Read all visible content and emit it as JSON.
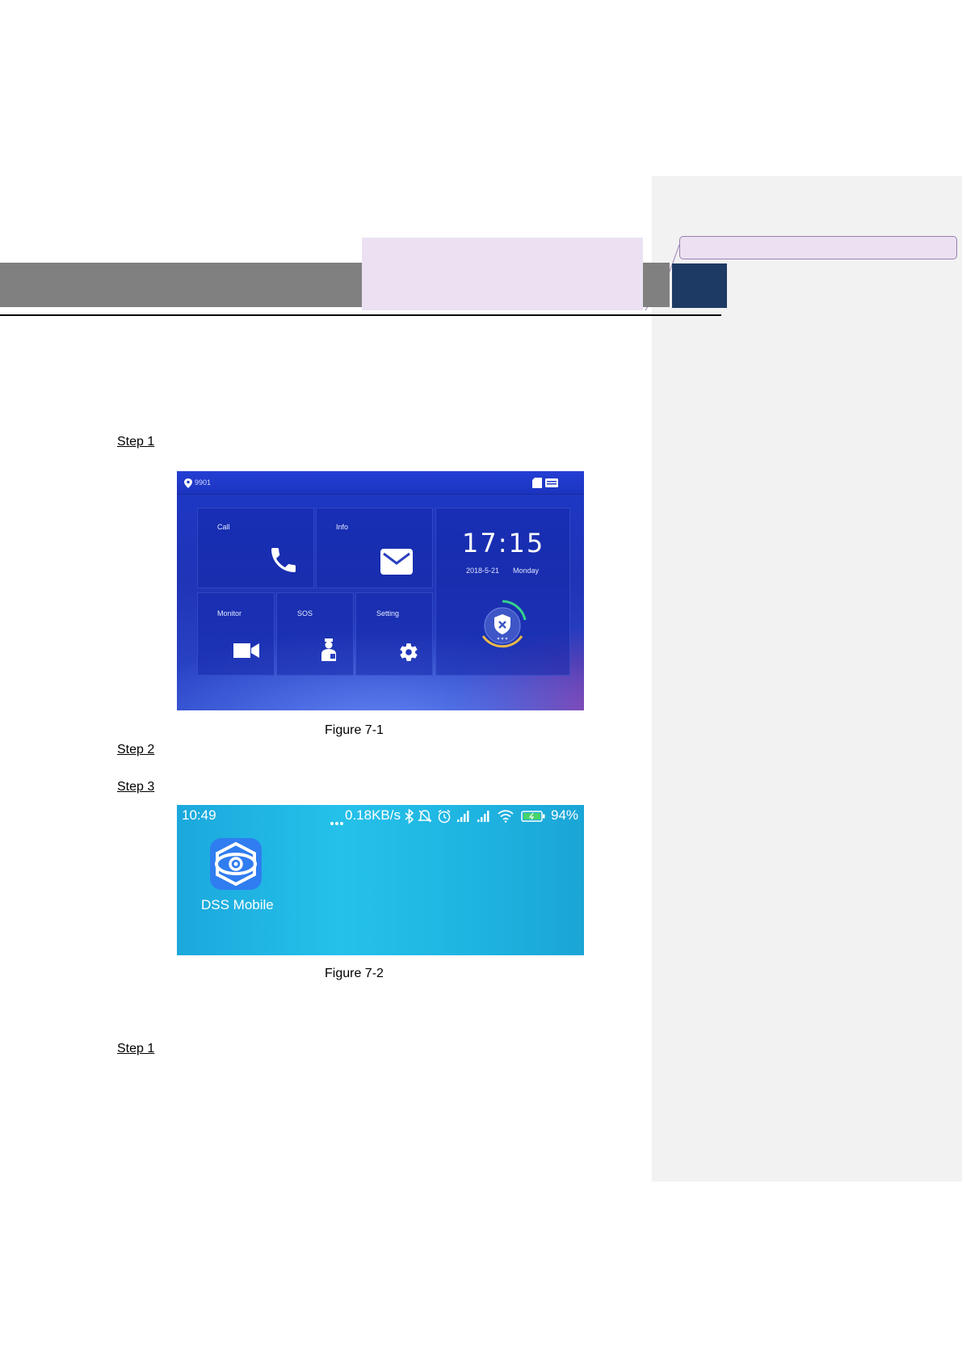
{
  "steps": {
    "step1_a": "Step 1",
    "step2": "Step 2",
    "step3": "Step 3",
    "step1_b": "Step 1"
  },
  "figure1": {
    "caption": "Figure 7-1",
    "room_no": "9901",
    "tiles": {
      "call": "Call",
      "info": "Info",
      "monitor": "Monitor",
      "sos": "SOS",
      "setting": "Setting"
    },
    "time": "17:15",
    "date": "2018-5-21",
    "weekday": "Monday",
    "icons": [
      "location-icon",
      "sd-card-icon",
      "message-icon",
      "phone-icon",
      "envelope-icon",
      "camera-icon",
      "sos-person-icon",
      "gear-icon",
      "shield-icon"
    ]
  },
  "figure2": {
    "caption": "Figure 7-2",
    "clock": "10:49",
    "net_speed": "0.18KB/s",
    "battery": "94%",
    "app_name": "DSS Mobile",
    "icons": [
      "bluetooth-icon",
      "bell-off-icon",
      "alarm-icon",
      "signal-icon",
      "wifi-icon",
      "battery-icon",
      "dss-mobile-app-icon"
    ]
  },
  "colors": {
    "header_band": "#808080",
    "header_block": "#1c3a64",
    "comment_highlight": "#ebe1f2",
    "comment_pane": "#f2f2f2"
  }
}
